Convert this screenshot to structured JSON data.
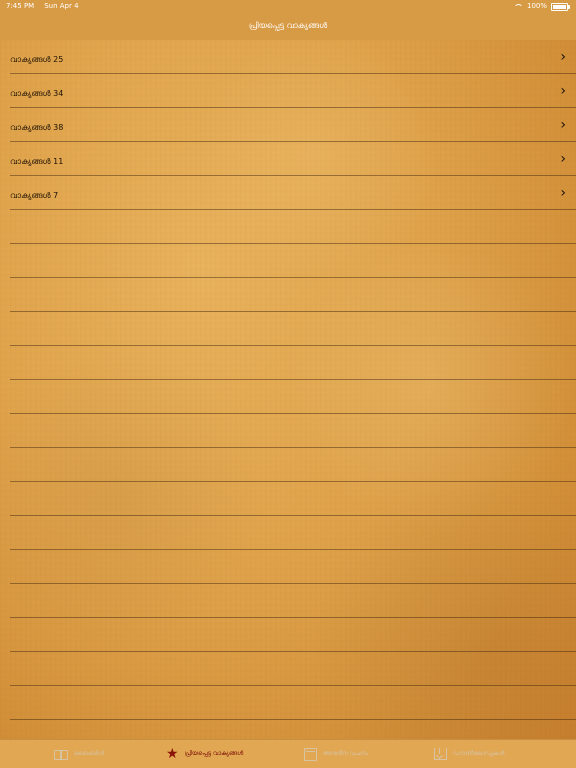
{
  "status_bar": {
    "time": "7:45 PM",
    "date": "Sun Apr 4",
    "battery": "100%"
  },
  "header": {
    "title": "പ്രിയപ്പെട്ട വാക്യങ്ങൾ"
  },
  "list": {
    "items": [
      {
        "label": "വാക്യങ്ങൾ 25"
      },
      {
        "label": "വാക്യങ്ങൾ 34"
      },
      {
        "label": "വാക്യങ്ങൾ 38"
      },
      {
        "label": "വാക്യങ്ങൾ 11"
      },
      {
        "label": "വാക്യങ്ങൾ 7"
      }
    ]
  },
  "tab_bar": {
    "tabs": [
      {
        "label": "ബൈബിൾ",
        "icon": "book-icon"
      },
      {
        "label": "പ്രിയപ്പെട്ട വാക്യങ്ങൾ",
        "icon": "star-icon"
      },
      {
        "label": "അനുദിന വചനം",
        "icon": "calendar-icon"
      },
      {
        "label": "ഡൗൺലോഡുകൾ",
        "icon": "download-icon"
      }
    ]
  },
  "colors": {
    "header_background": "#d89b45",
    "active_tab": "#7b1308",
    "inactive_tab": "#d7c2a1",
    "separator": "#4a2a10"
  }
}
